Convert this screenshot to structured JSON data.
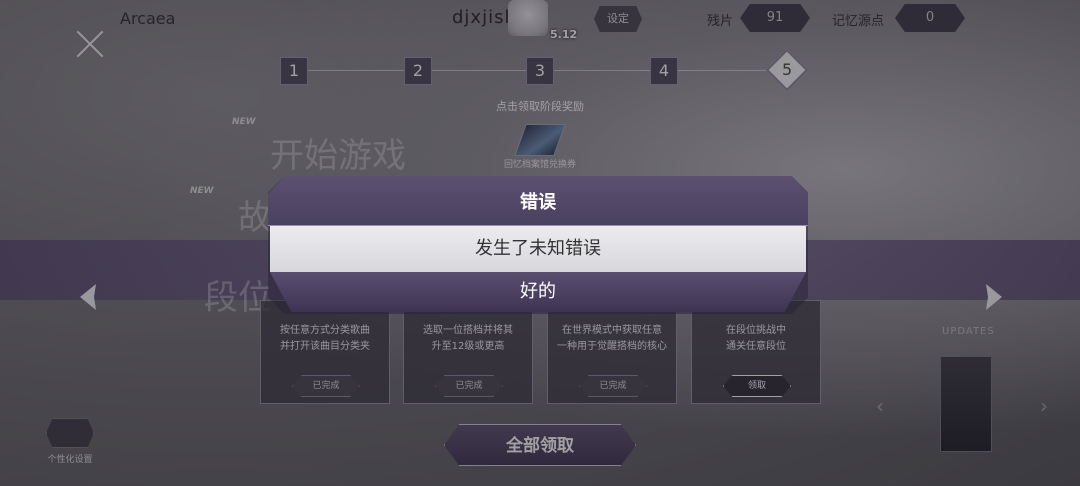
{
  "app_title": "Arcaea",
  "user": {
    "name": "djxjish",
    "rating": "5.12"
  },
  "topbar": {
    "settings_label": "设定",
    "fragments_label": "残片",
    "fragments_value": "91",
    "memory_label": "记忆源点",
    "memory_value": "0"
  },
  "stages": [
    "1",
    "2",
    "3",
    "4",
    "5"
  ],
  "stage_hint": "点击领取阶段奖励",
  "reward_label": "回忆档案馆兑换券",
  "menu": {
    "new_tag": "NEW",
    "start_game": "开始游戏",
    "story_partial": "故",
    "ranked_partial": "段位"
  },
  "tasks": [
    {
      "desc_line1": "按任意方式分类歌曲",
      "desc_line2": "并打开该曲目分类夹",
      "button": "已完成"
    },
    {
      "desc_line1": "选取一位搭档并将其",
      "desc_line2": "升至12级或更高",
      "button": "已完成"
    },
    {
      "desc_line1": "在世界模式中获取任意",
      "desc_line2": "一种用于觉醒搭档的核心",
      "button": "已完成"
    },
    {
      "desc_line1": "在段位挑战中",
      "desc_line2": "通关任意段位",
      "button": "领取"
    }
  ],
  "updates_label": "UPDATES",
  "claim_all_label": "全部领取",
  "personalize_label": "个性化设置",
  "dialog": {
    "title": "错误",
    "message": "发生了未知错误",
    "ok_label": "好的"
  }
}
